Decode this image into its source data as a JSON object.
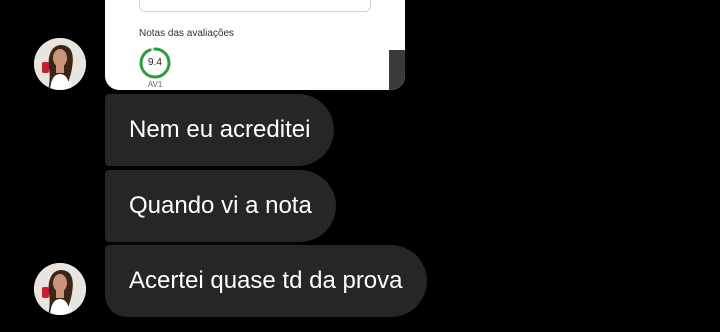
{
  "chat": {
    "shared_card": {
      "section_label": "Notas das avaliações",
      "grade_value": "9.4",
      "grade_label": "AV1",
      "grade_fraction": 0.94,
      "ring_color": "#2e9e3a"
    },
    "messages": [
      {
        "text": "Nem eu acreditei"
      },
      {
        "text": "Quando vi a nota"
      },
      {
        "text": "Acertei quase td da prova"
      }
    ],
    "colors": {
      "background": "#000000",
      "bubble": "#262626",
      "bubble_text": "#ffffff"
    }
  }
}
